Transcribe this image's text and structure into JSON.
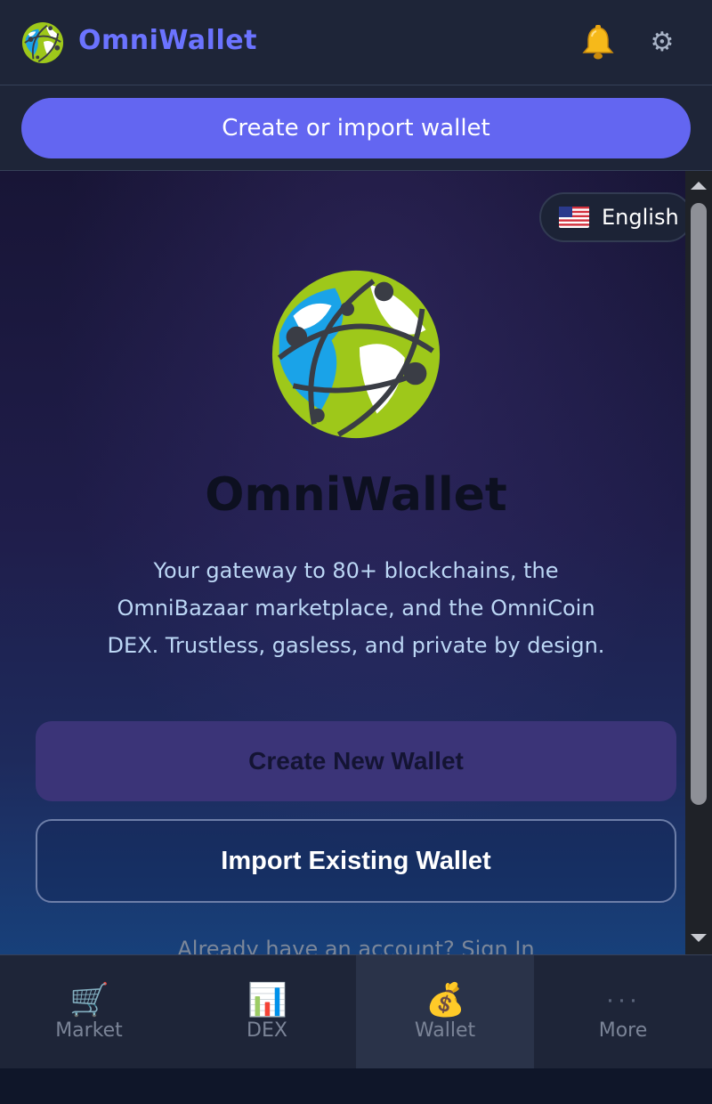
{
  "app": {
    "name": "OmniWallet",
    "accent_color": "#6366f1",
    "brand_text_color": "#6b73ff"
  },
  "header": {
    "notifications_icon": "bell-icon",
    "settings_icon": "gear-icon",
    "settings_glyph": "⚙"
  },
  "topbar": {
    "create_import_label": "Create or import wallet"
  },
  "language": {
    "flag": "us-flag-icon",
    "label": "English"
  },
  "hero": {
    "title": "OmniWallet",
    "description": "Your gateway to 80+ blockchains, the OmniBazaar marketplace, and the OmniCoin DEX. Trustless, gasless, and private by design."
  },
  "actions": {
    "create_label": "Create New Wallet",
    "import_label": "Import Existing Wallet",
    "signin_text": "Already have an account? Sign In"
  },
  "bottom_nav": {
    "items": [
      {
        "label": "Market",
        "icon": "cart-icon",
        "glyph": "🛒",
        "active": false
      },
      {
        "label": "DEX",
        "icon": "chart-icon",
        "glyph": "📊",
        "active": false
      },
      {
        "label": "Wallet",
        "icon": "money-bag-icon",
        "glyph": "💰",
        "active": true
      },
      {
        "label": "More",
        "icon": "more-dots-icon",
        "glyph": "···",
        "active": false
      }
    ]
  }
}
